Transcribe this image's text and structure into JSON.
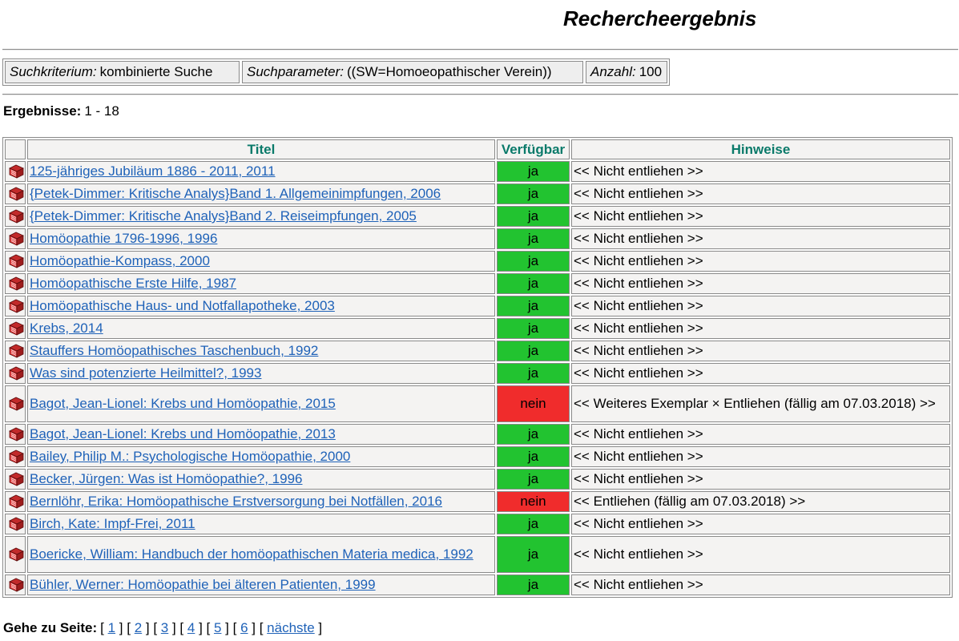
{
  "page": {
    "title": "Rechercheergebnis"
  },
  "criteria": {
    "kriterium_label": "Suchkriterium:",
    "kriterium_value": "kombinierte Suche",
    "parameter_label": "Suchparameter:",
    "parameter_value": "((SW=Homoeopathischer Verein))",
    "anzahl_label": "Anzahl:",
    "anzahl_value": "100"
  },
  "results": {
    "label": "Ergebnisse:",
    "range": "1 - 18",
    "columns": {
      "titel": "Titel",
      "verfuegbar": "Verfügbar",
      "hinweise": "Hinweise"
    },
    "rows": [
      {
        "title": "125-jähriges Jubiläum 1886 - 2011, 2011",
        "available": "ja",
        "note": "<< Nicht entliehen >>"
      },
      {
        "title": "{Petek-Dimmer: Kritische Analys}Band 1. Allgemeinimpfungen, 2006",
        "available": "ja",
        "note": "<< Nicht entliehen >>"
      },
      {
        "title": "{Petek-Dimmer: Kritische Analys}Band 2. Reiseimpfungen, 2005",
        "available": "ja",
        "note": "<< Nicht entliehen >>"
      },
      {
        "title": "Homöopathie 1796-1996, 1996",
        "available": "ja",
        "note": "<< Nicht entliehen >>"
      },
      {
        "title": "Homöopathie-Kompass, 2000",
        "available": "ja",
        "note": "<< Nicht entliehen >>"
      },
      {
        "title": "Homöopathische Erste Hilfe, 1987",
        "available": "ja",
        "note": "<< Nicht entliehen >>"
      },
      {
        "title": "Homöopathische Haus- und Notfallapotheke, 2003",
        "available": "ja",
        "note": "<< Nicht entliehen >>"
      },
      {
        "title": "Krebs, 2014",
        "available": "ja",
        "note": "<< Nicht entliehen >>"
      },
      {
        "title": "Stauffers Homöopathisches Taschenbuch, 1992",
        "available": "ja",
        "note": "<< Nicht entliehen >>"
      },
      {
        "title": "Was sind potenzierte Heilmittel?, 1993",
        "available": "ja",
        "note": "<< Nicht entliehen >>"
      },
      {
        "title": "Bagot, Jean-Lionel: Krebs und Homöopathie, 2015",
        "available": "nein",
        "note": "<< Weiteres Exemplar × Entliehen (fällig am 07.03.2018) >>"
      },
      {
        "title": "Bagot, Jean-Lionel: Krebs und Homöopathie, 2013",
        "available": "ja",
        "note": "<< Nicht entliehen >>"
      },
      {
        "title": "Bailey, Philip M.: Psychologische Homöopathie, 2000",
        "available": "ja",
        "note": "<< Nicht entliehen >>"
      },
      {
        "title": "Becker, Jürgen: Was ist Homöopathie?, 1996",
        "available": "ja",
        "note": "<< Nicht entliehen >>"
      },
      {
        "title": "Bernlöhr, Erika: Homöopathische Erstversorgung bei Notfällen, 2016",
        "available": "nein",
        "note": "<< Entliehen (fällig am 07.03.2018) >>"
      },
      {
        "title": "Birch, Kate: Impf-Frei, 2011",
        "available": "ja",
        "note": "<< Nicht entliehen >>"
      },
      {
        "title": "Boericke, William: Handbuch der homöopathischen Materia medica, 1992",
        "available": "ja",
        "note": "<< Nicht entliehen >>"
      },
      {
        "title": "Bühler, Werner: Homöopathie bei älteren Patienten, 1999",
        "available": "ja",
        "note": "<< Nicht entliehen >>"
      }
    ]
  },
  "pager": {
    "label": "Gehe zu Seite:",
    "pages": [
      "1",
      "2",
      "3",
      "4",
      "5",
      "6"
    ],
    "next": "nächste"
  },
  "icons": {
    "row_icon": "book-icon"
  },
  "colors": {
    "available_yes": "#22c330",
    "available_no": "#f02c2c",
    "link": "#1f62b8",
    "header_text": "#0a7a6a"
  }
}
